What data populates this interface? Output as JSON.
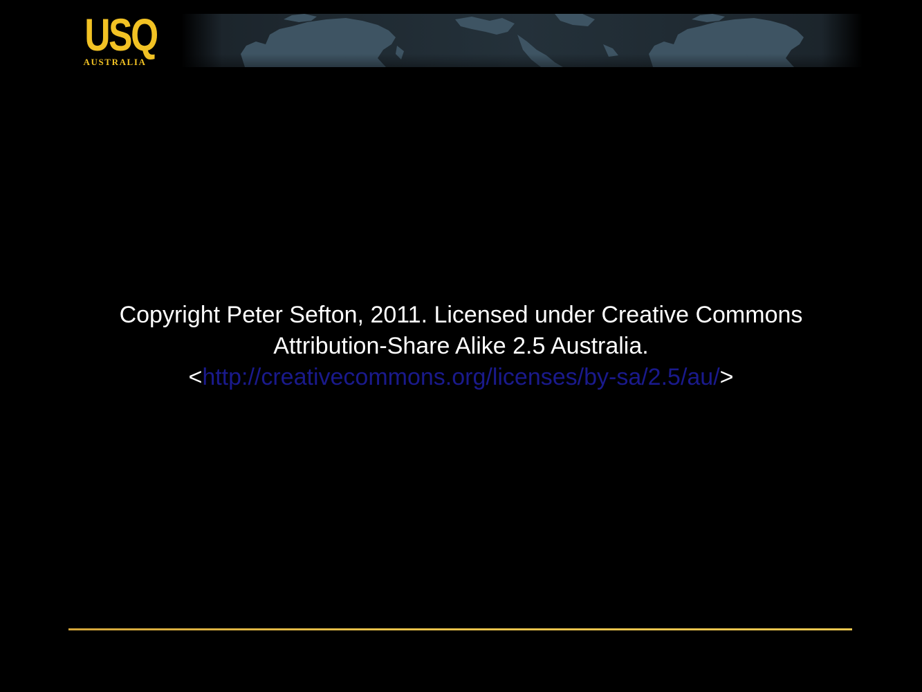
{
  "logo": {
    "main": "USQ",
    "sub": "AUSTRALIA"
  },
  "slide": {
    "line1": "Copyright Peter Sefton, 2011. Licensed under Creative Commons",
    "line2": "Attribution-Share Alike 2.5 Australia.",
    "link_open": "<",
    "link_text": "http://creativecommons.org/licenses/by-sa/2.5/au/",
    "link_close": ">"
  },
  "colors": {
    "background": "#000000",
    "text": "#ffffff",
    "accent": "#f2c224",
    "link": "#1a1a8c",
    "map": "#3e5463"
  }
}
